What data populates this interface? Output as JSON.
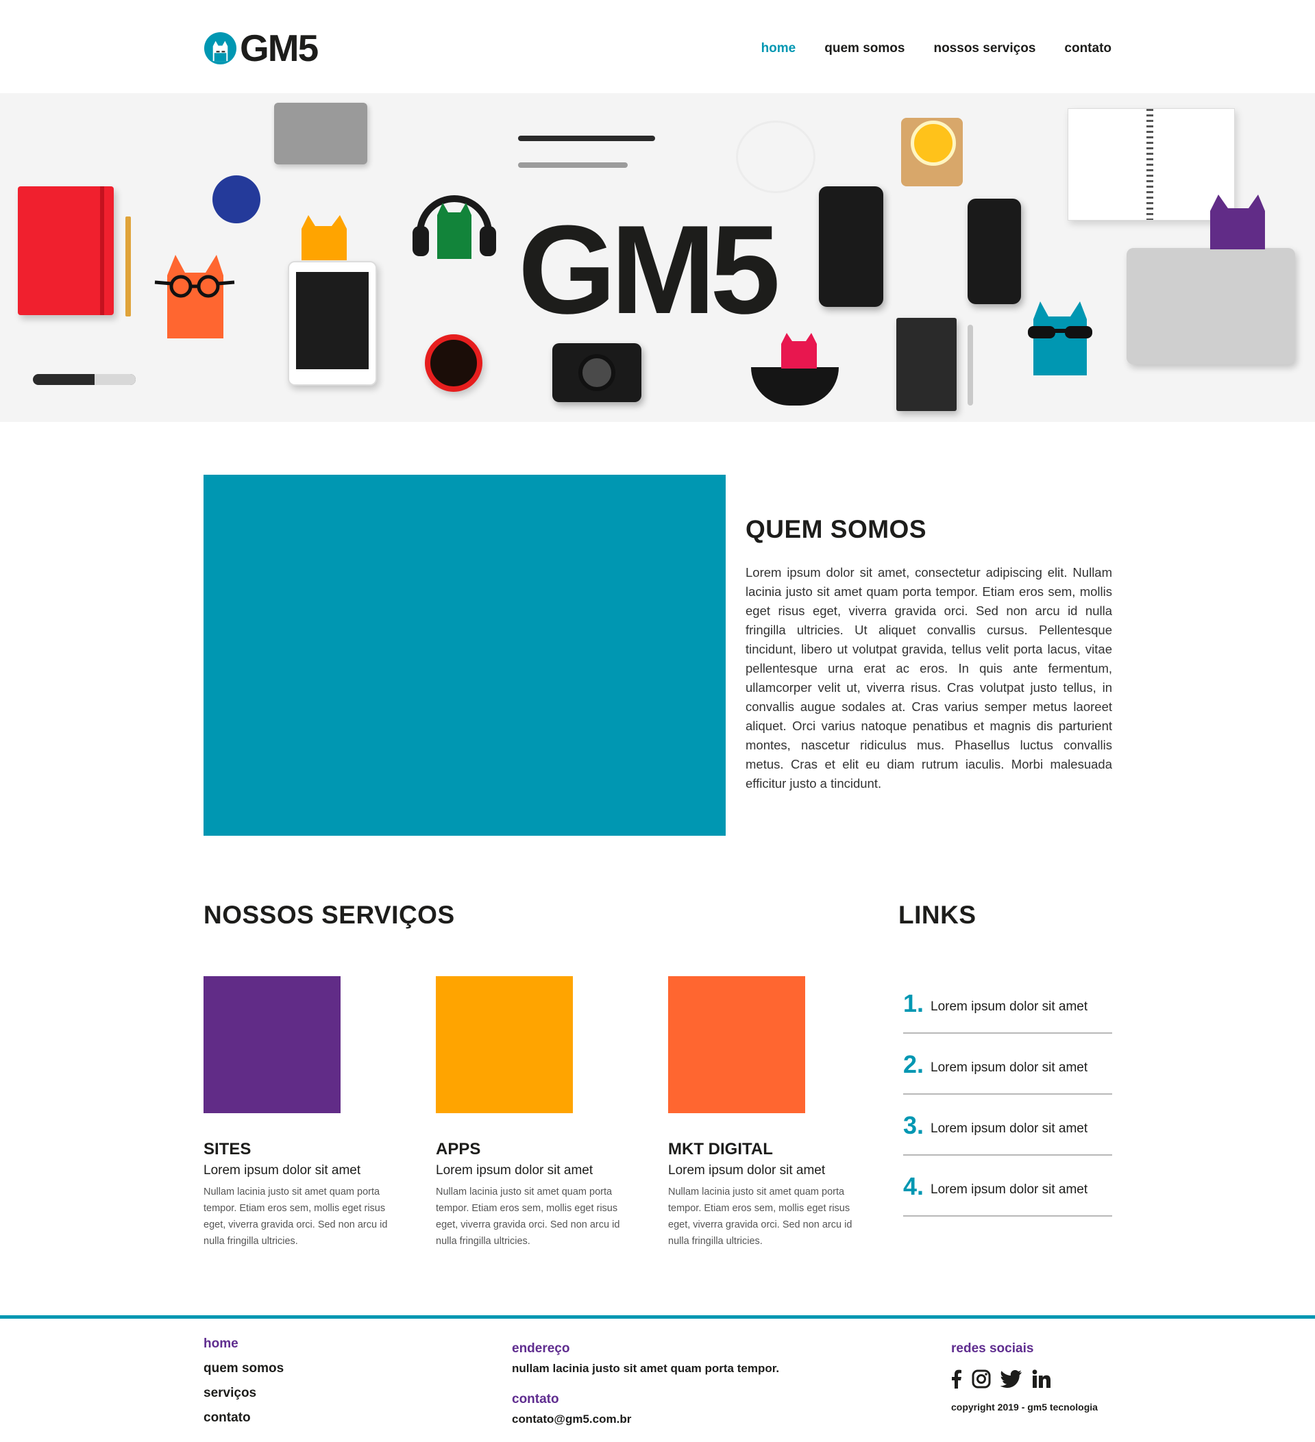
{
  "header": {
    "logo_text": "GM5",
    "nav": [
      {
        "label": "home",
        "active": true
      },
      {
        "label": "quem somos",
        "active": false
      },
      {
        "label": "nossos serviços",
        "active": false
      },
      {
        "label": "contato",
        "active": false
      }
    ]
  },
  "hero": {
    "title": "GM5"
  },
  "about": {
    "title": "QUEM SOMOS",
    "text": "Lorem ipsum dolor sit amet, consectetur adipiscing elit. Nullam lacinia justo sit amet quam porta tempor. Etiam eros sem, mollis eget risus eget, viverra gravida orci. Sed non arcu id nulla fringilla ultricies. Ut aliquet convallis cursus. Pellentesque tincidunt, libero ut volutpat gravida, tellus velit porta lacus, vitae pellentesque urna erat ac eros. In quis ante fermentum, ullamcorper velit ut, viverra risus. Cras volutpat justo tellus, in convallis augue sodales at. Cras varius semper metus laoreet aliquet. Orci varius natoque penatibus et magnis dis parturient montes, nascetur ridiculus mus. Phasellus luctus convallis metus. Cras et elit eu diam rutrum iaculis. Morbi malesuada efficitur justo a tincidunt.",
    "block_color": "#0097b2"
  },
  "services": {
    "title": "NOSSOS SERVIÇOS",
    "items": [
      {
        "title": "SITES",
        "subtitle": "Lorem ipsum dolor sit amet",
        "text": "Nullam lacinia justo sit amet quam porta tempor. Etiam eros sem, mollis eget risus eget, viverra gravida orci. Sed non arcu id nulla fringilla ultricies.",
        "color": "#612c87"
      },
      {
        "title": "APPS",
        "subtitle": "Lorem ipsum dolor sit amet",
        "text": "Nullam lacinia justo sit amet quam porta tempor. Etiam eros sem, mollis eget risus eget, viverra gravida orci. Sed non arcu id nulla fringilla ultricies.",
        "color": "#ffa400"
      },
      {
        "title": "MKT DIGITAL",
        "subtitle": "Lorem ipsum dolor sit amet",
        "text": "Nullam lacinia justo sit amet quam porta tempor. Etiam eros sem, mollis eget risus eget, viverra gravida orci. Sed non arcu id nulla fringilla ultricies.",
        "color": "#ff6630"
      }
    ]
  },
  "links": {
    "title": "LINKS",
    "items": [
      {
        "num": "1.",
        "text": "Lorem ipsum dolor sit amet"
      },
      {
        "num": "2.",
        "text": "Lorem ipsum dolor sit amet"
      },
      {
        "num": "3.",
        "text": "Lorem ipsum dolor sit amet"
      },
      {
        "num": "4.",
        "text": "Lorem ipsum dolor sit amet"
      }
    ]
  },
  "footer": {
    "nav": [
      {
        "label": "home",
        "active": true
      },
      {
        "label": "quem somos",
        "active": false
      },
      {
        "label": "serviços",
        "active": false
      },
      {
        "label": "contato",
        "active": false
      }
    ],
    "address_heading": "endereço",
    "address_value": "nullam lacinia justo sit amet quam porta tempor.",
    "contact_heading": "contato",
    "contact_value": "contato@gm5.com.br",
    "social_heading": "redes sociais",
    "social_icons": [
      "facebook-icon",
      "instagram-icon",
      "twitter-icon",
      "linkedin-icon"
    ],
    "copyright": "copyright 2019 - gm5 tecnologia"
  },
  "colors": {
    "accent": "#0097b2",
    "purple": "#5f2d8f",
    "text": "#1d1d1b"
  }
}
